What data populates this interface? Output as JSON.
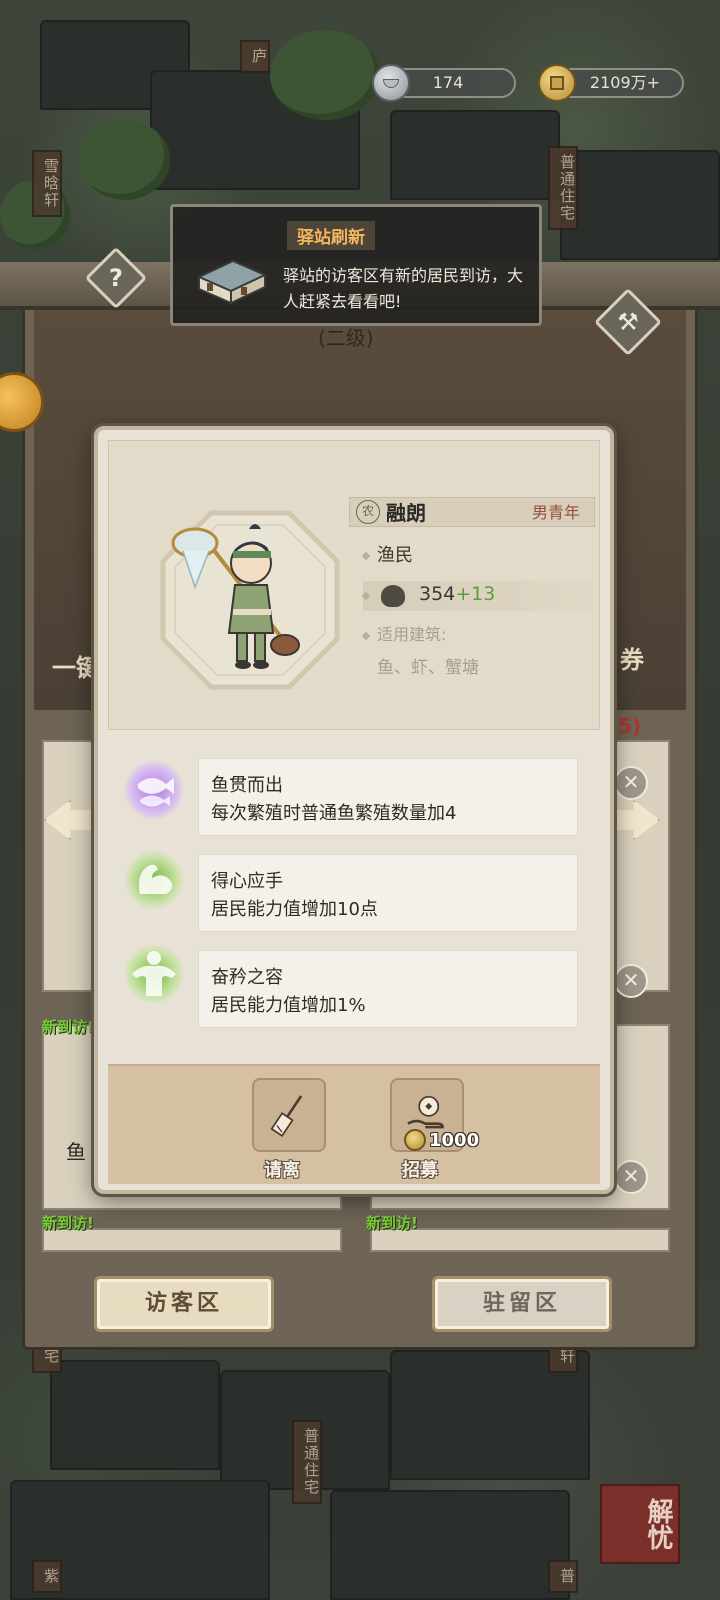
{
  "resources": {
    "silver": "174",
    "coins": "2109万+"
  },
  "map_signs": {
    "top_center": "庐",
    "left_top": "雪晗轩",
    "right_top": "普通住宅",
    "left_bottom": "宅",
    "center_bottom": "普通住宅",
    "right_bottom": "轩",
    "bottom_left": "紫",
    "bottom_right": "普"
  },
  "notification": {
    "title": "驿站刷新",
    "message": "驿站的访客区有新的居民到访，大人赶紧去看看吧!"
  },
  "station": {
    "level": "(二级)",
    "help_icon": "?",
    "peek_left": "一键",
    "peek_right": "券",
    "count_fragment": "5)",
    "new_tag_1": "新到访!",
    "new_tag_2": "新到访!",
    "new_tag_3": "新到访!",
    "list_item_partial": "鱼"
  },
  "resident": {
    "category_badge": "农",
    "name": "融朗",
    "type": "男青年",
    "occupation": "渔民",
    "power_base": "354",
    "power_bonus": "+13",
    "suitable_label": "适用建筑:",
    "suitable_value": "鱼、虾、蟹塘"
  },
  "skills": [
    {
      "icon": "fish-icon",
      "name": "鱼贯而出",
      "desc": "每次繁殖时普通鱼繁殖数量加4"
    },
    {
      "icon": "arm-muscle-icon",
      "name": "得心应手",
      "desc": "居民能力值增加10点"
    },
    {
      "icon": "body-muscle-icon",
      "name": "奋矜之容",
      "desc": "居民能力值增加1%"
    }
  ],
  "actions": {
    "dismiss_label": "请离",
    "recruit_label": "招募",
    "recruit_cost": "1000"
  },
  "tabs": {
    "visitor": "访客区",
    "stay": "驻留区"
  },
  "corner_badge": "解忧",
  "colors": {
    "accent_orange": "#f2b75e",
    "bonus_green": "#5e9c3a",
    "type_red": "#9a4e3a",
    "new_tag_green": "#7ecb3c"
  }
}
